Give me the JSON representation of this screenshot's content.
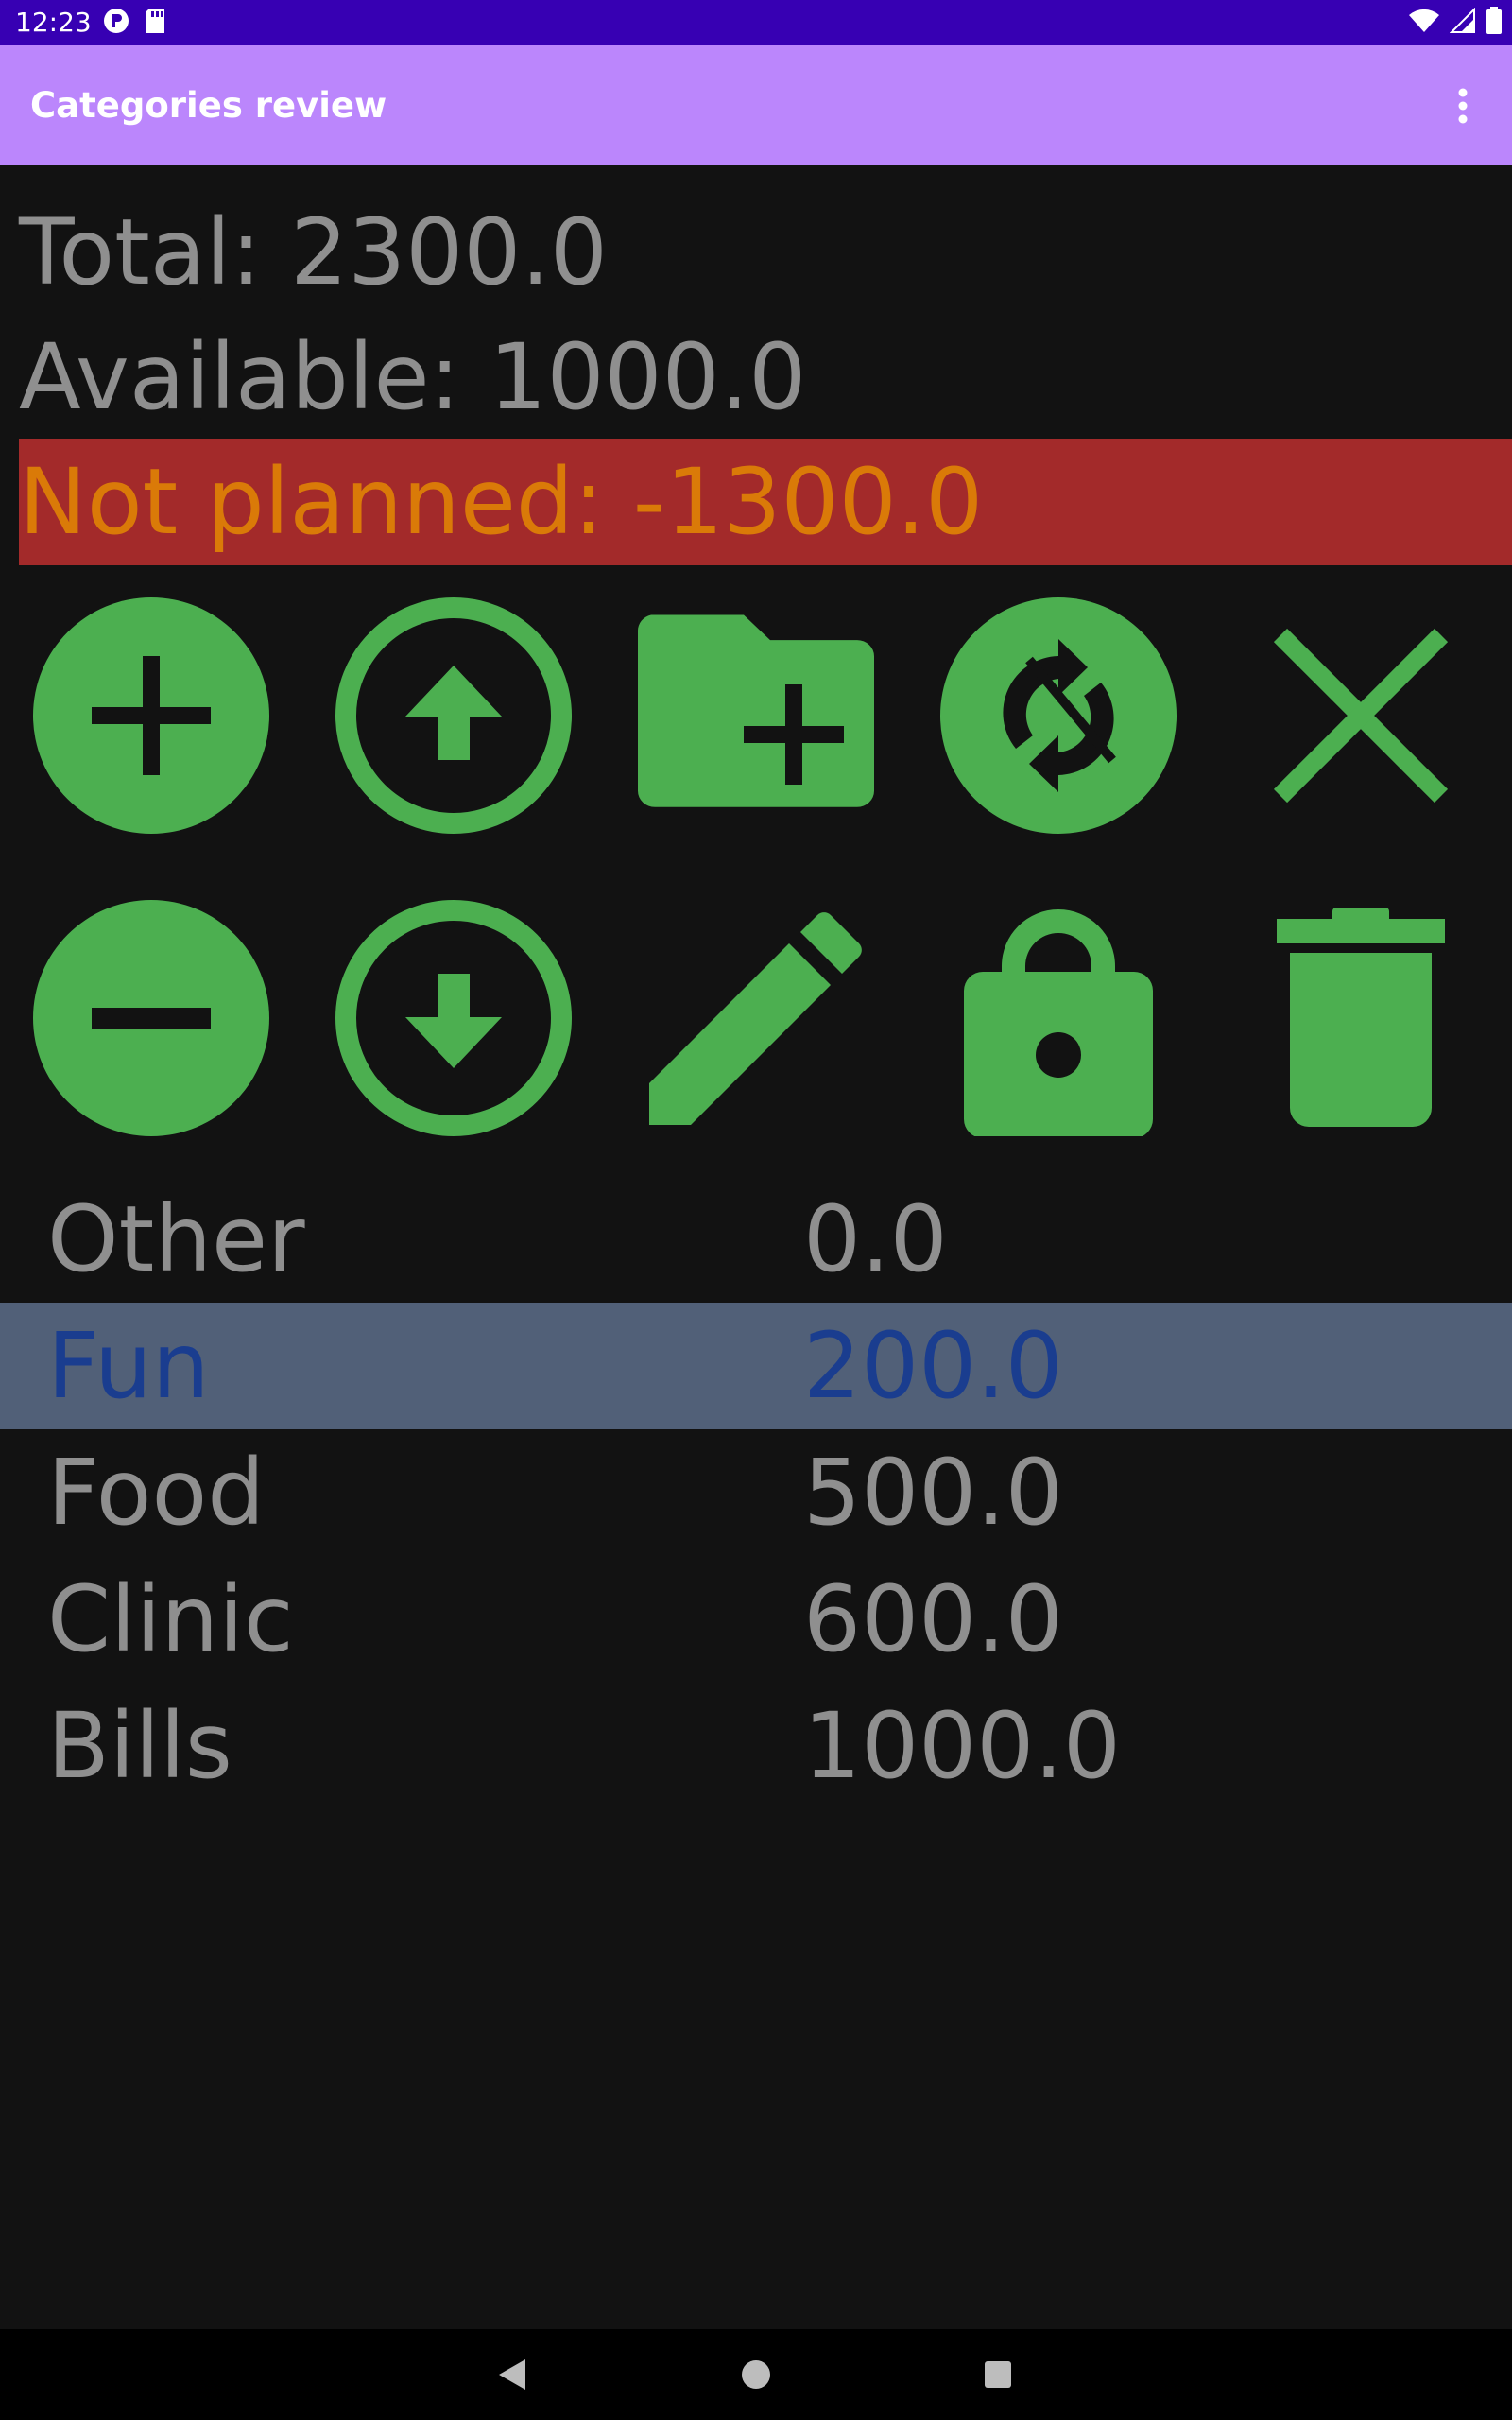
{
  "status_bar": {
    "time": "12:23",
    "icons": [
      "notification-app-icon",
      "sd-card-icon",
      "wifi-icon",
      "signal-icon",
      "battery-icon"
    ]
  },
  "app_bar": {
    "title": "Categories review",
    "overflow_icon": "more-vert-icon",
    "background": "#bb86fc"
  },
  "summary": {
    "total": "Total: 2300.0",
    "available": "Available: 1000.0",
    "not_planned": "Not planned: -1300.0",
    "not_planned_bg": "#a32a2a",
    "not_planned_color": "#da7a08"
  },
  "toolbar": {
    "icon_color": "#4caf50",
    "row1": [
      "add-circle-icon",
      "arrow-up-circle-icon",
      "create-folder-icon",
      "sync-icon",
      "close-icon"
    ],
    "row2": [
      "remove-circle-icon",
      "arrow-down-circle-icon",
      "edit-pencil-icon",
      "lock-icon",
      "delete-icon"
    ]
  },
  "categories": [
    {
      "name": "Other",
      "amount": "0.0",
      "selected": false
    },
    {
      "name": "Fun",
      "amount": "200.0",
      "selected": true
    },
    {
      "name": "Food",
      "amount": "500.0",
      "selected": false
    },
    {
      "name": "Clinic",
      "amount": "600.0",
      "selected": false
    },
    {
      "name": "Bills",
      "amount": "1000.0",
      "selected": false
    }
  ],
  "nav_bar": {
    "icons": [
      "back-icon",
      "home-icon",
      "recents-icon"
    ]
  }
}
